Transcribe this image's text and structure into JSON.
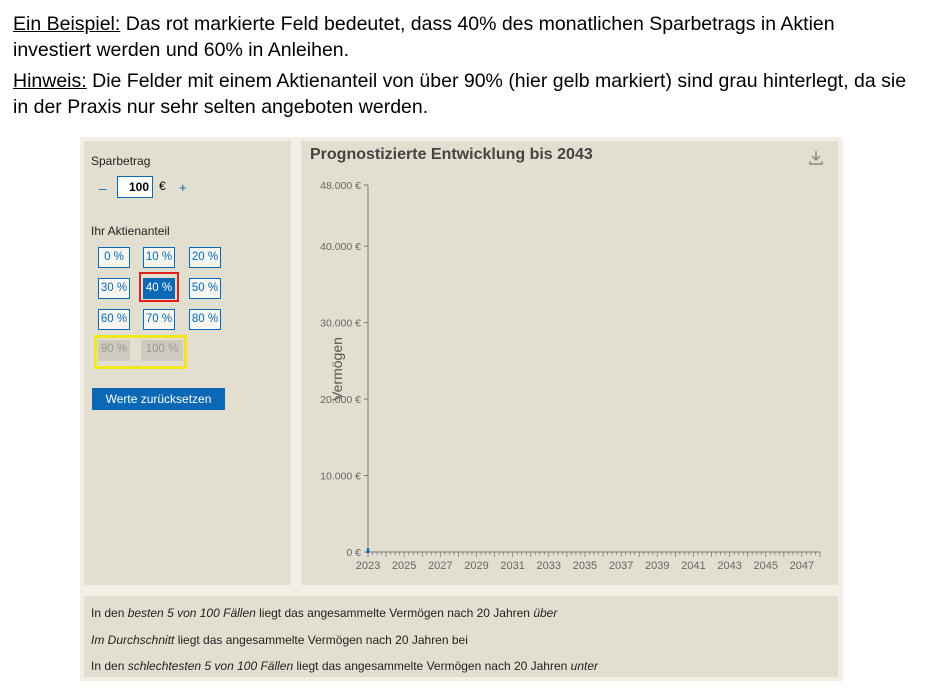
{
  "intro": {
    "p1_lead": "Ein Beispiel:",
    "p1_text": " Das rot markierte Feld bedeutet, dass 40% des monatlichen Sparbetrags in Aktien investiert werden und 60% in Anleihen.",
    "p2_lead": "Hinweis:",
    "p2_text": " Die Felder mit einem Aktienanteil von über 90% (hier gelb markiert) sind grau hinterlegt, da sie in der Praxis nur sehr selten angeboten werden."
  },
  "left": {
    "sparbetrag_label": "Sparbetrag",
    "minus": "–",
    "amount": "100",
    "currency": "€",
    "plus": "+",
    "aktienanteil_label": "Ihr Aktienanteil",
    "buttons": [
      "0 %",
      "10 %",
      "20 %",
      "30 %",
      "40 %",
      "50 %",
      "60 %",
      "70 %",
      "80 %",
      "90 %",
      "100 %"
    ],
    "selected": "40 %",
    "reset_label": "Werte zurücksetzen"
  },
  "chart_data": {
    "type": "line",
    "title": "Prognostizierte Entwicklung bis 2043",
    "ylabel": "Vermögen",
    "xlabel": "",
    "xlim": [
      2023,
      2048
    ],
    "ylim": [
      0,
      48000
    ],
    "y_ticks": [
      "0 €",
      "10.000 €",
      "20.000 €",
      "30.000 €",
      "40.000 €",
      "48.000 €"
    ],
    "y_tick_values": [
      0,
      10000,
      20000,
      30000,
      40000,
      48000
    ],
    "x_ticks": [
      "2023",
      "2025",
      "2027",
      "2029",
      "2031",
      "2033",
      "2035",
      "2037",
      "2039",
      "2041",
      "2043",
      "2045",
      "2047"
    ],
    "x_tick_values": [
      2023,
      2025,
      2027,
      2029,
      2031,
      2033,
      2035,
      2037,
      2039,
      2041,
      2043,
      2045,
      2047
    ],
    "series": [
      {
        "x": [
          2023
        ],
        "y": [
          100
        ],
        "color": "#0a68b4"
      }
    ]
  },
  "bottom": {
    "l1a": "In den ",
    "l1b": "besten 5 von 100 Fällen",
    "l1c": " liegt das angesammelte Vermögen nach 20 Jahren ",
    "l1d": "über",
    "l2a": "Im Durchschnitt",
    "l2b": " liegt das angesammelte Vermögen nach 20 Jahren bei",
    "l3a": "In den ",
    "l3b": "schlechtesten 5 von 100 Fällen",
    "l3c": " liegt das angesammelte Vermögen nach 20 Jahren ",
    "l3d": "unter"
  },
  "colors": {
    "accent": "#0a68b4",
    "panel": "#e3dfd0",
    "red_marker": "#e0201a",
    "yellow_marker": "#f5e71a"
  },
  "icons": {
    "download": "download-icon"
  }
}
